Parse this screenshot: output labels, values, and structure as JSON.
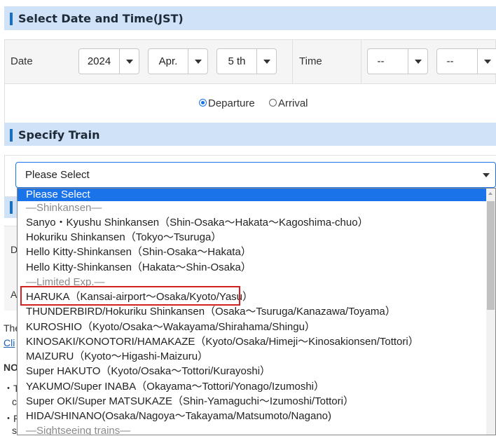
{
  "date_time_section": {
    "title": "Select Date and Time(JST)",
    "date_label": "Date",
    "year": "2024",
    "month": "Apr.",
    "day": "5 th",
    "time_label": "Time",
    "hour": "--",
    "minute": "--",
    "radio": {
      "departure": "Departure",
      "arrival": "Arrival",
      "selected": "departure"
    }
  },
  "train_section": {
    "title": "Specify Train",
    "select_value": "Please Select"
  },
  "background_fragments": {
    "d": "D",
    "a": "A",
    "the": "The",
    "cli": "Cli",
    "no": "NO",
    "bullet1": "・T",
    "c": "c",
    "bullet2": "・F",
    "s": "s"
  },
  "dropdown": {
    "options": [
      {
        "label": "Please Select",
        "type": "selected"
      },
      {
        "label": "—Shinkansen—",
        "type": "group"
      },
      {
        "label": "Sanyo・Kyushu Shinkansen（Shin-Osaka～Hakata～Kagoshima-chuo）",
        "type": "option"
      },
      {
        "label": "Hokuriku Shinkansen（Tokyo～Tsuruga）",
        "type": "option"
      },
      {
        "label": "Hello Kitty-Shinkansen（Shin-Osaka～Hakata）",
        "type": "option"
      },
      {
        "label": "Hello Kitty-Shinkansen（Hakata～Shin-Osaka）",
        "type": "option"
      },
      {
        "label": "—Limited Exp.—",
        "type": "group"
      },
      {
        "label": "HARUKA（Kansai-airport～Osaka/Kyoto/Yasu）",
        "type": "option"
      },
      {
        "label": "THUNDERBIRD/Hokuriku Shinkansen（Osaka～Tsuruga/Kanazawa/Toyama）",
        "type": "option"
      },
      {
        "label": "KUROSHIO（Kyoto/Osaka～Wakayama/Shirahama/Shingu）",
        "type": "option"
      },
      {
        "label": "KINOSAKI/KONOTORI/HAMAKAZE（Kyoto/Osaka/Himeji～Kinosakionsen/Tottori）",
        "type": "option"
      },
      {
        "label": "MAIZURU（Kyoto～Higashi-Maizuru）",
        "type": "option"
      },
      {
        "label": "Super HAKUTO（Kyoto/Osaka～Tottori/Kurayoshi）",
        "type": "option"
      },
      {
        "label": "YAKUMO/Super INABA（Okayama～Tottori/Yonago/Izumoshi）",
        "type": "option"
      },
      {
        "label": "Super OKI/Super MATSUKAZE（Shin-Yamaguchi～Izumoshi/Tottori）",
        "type": "option"
      },
      {
        "label": "HIDA/SHINANO(Osaka/Nagoya～Takayama/Matsumoto/Nagano)",
        "type": "option"
      },
      {
        "label": "—Sightseeing trains—",
        "type": "group"
      }
    ]
  },
  "colors": {
    "accent": "#1a73e8",
    "header_bg": "#cfe2f7",
    "highlight": "#d32020"
  }
}
